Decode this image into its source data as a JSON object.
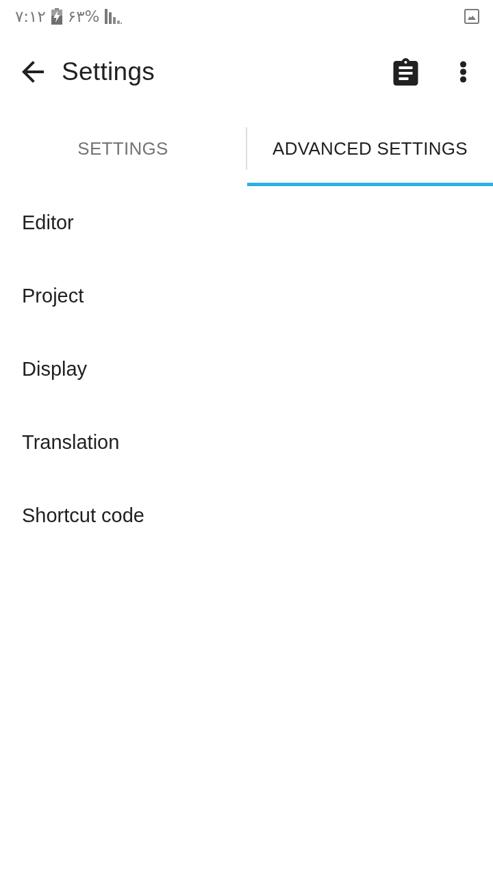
{
  "status_bar": {
    "time": "۷:۱۲",
    "battery": "۶۳%"
  },
  "toolbar": {
    "title": "Settings"
  },
  "tabs": [
    {
      "label": "SETTINGS",
      "selected": false
    },
    {
      "label": "ADVANCED SETTINGS",
      "selected": true
    }
  ],
  "items": [
    {
      "label": "Editor"
    },
    {
      "label": "Project"
    },
    {
      "label": "Display"
    },
    {
      "label": "Translation"
    },
    {
      "label": "Shortcut code"
    }
  ]
}
